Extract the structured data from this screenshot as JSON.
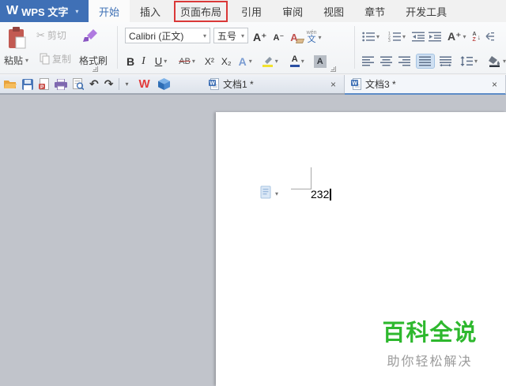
{
  "titlebar": {
    "logo_w": "W",
    "logo_text": "WPS 文字",
    "tabs": [
      {
        "label": "开始"
      },
      {
        "label": "插入"
      },
      {
        "label": "页面布局"
      },
      {
        "label": "引用"
      },
      {
        "label": "审阅"
      },
      {
        "label": "视图"
      },
      {
        "label": "章节"
      },
      {
        "label": "开发工具"
      }
    ]
  },
  "ribbon": {
    "paste_label": "粘贴",
    "cut_label": "剪切",
    "copy_label": "复制",
    "format_painter_label": "格式刷",
    "font_family": "Calibri (正文)",
    "font_size": "五号",
    "bold": "B",
    "italic": "I",
    "underline": "U",
    "strikethrough": "AB",
    "superscript": "X²",
    "subscript": "X₂",
    "grow_font": "A⁺",
    "shrink_font": "A⁻",
    "clear_format": "A",
    "phonetic_top": "wén",
    "phonetic_bottom": "文",
    "text_effect": "A",
    "font_color": "A",
    "char_shading": "A",
    "sort_a": "A",
    "sort_z": "Z"
  },
  "icons": {
    "dropdown": "▾",
    "scissors": "✂",
    "undo": "↶",
    "redo": "↷",
    "close": "×",
    "sort_arrow": "↓"
  },
  "tabbar": {
    "wps_w": "W",
    "documents": [
      {
        "label": "文档1 *"
      },
      {
        "label": "文档3 *"
      }
    ]
  },
  "document": {
    "text": "232"
  },
  "watermark": {
    "title": "百科全说",
    "subtitle": "助你轻松解决"
  },
  "colors": {
    "accent_blue": "#3e70b5",
    "highlight_red": "#da3838",
    "watermark_green": "#2eb82e",
    "active_tab_underline": "#5d8cc7"
  }
}
